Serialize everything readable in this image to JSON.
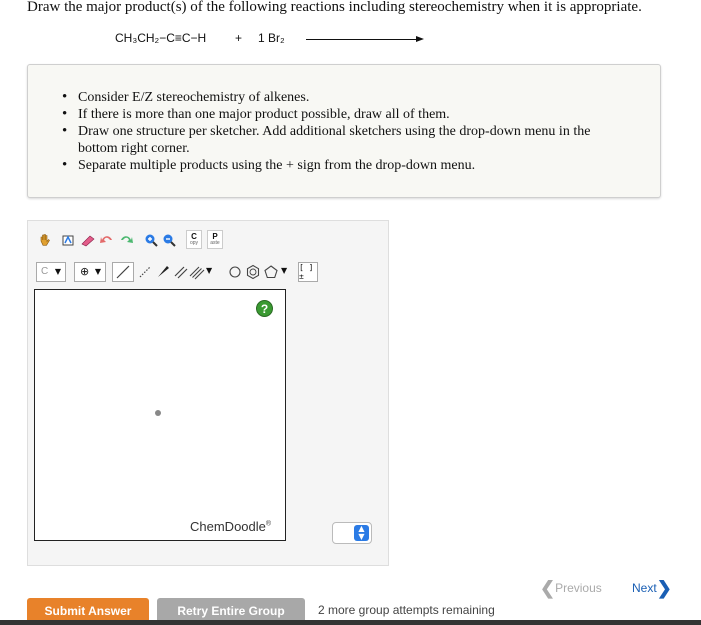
{
  "question": {
    "prompt": "Draw the major product(s) of the following reactions including stereochemistry when it is appropriate.",
    "reactant": "CH₃CH₂−C≡C−H",
    "plus": "+",
    "reagent": "1 Br₂"
  },
  "instructions": [
    "Consider E/Z stereochemistry of alkenes.",
    "If there is more than one major product possible, draw all of them.",
    "Draw one structure per sketcher. Add additional sketchers using the drop-down menu in the bottom right corner.",
    "Separate multiple products using the + sign from the drop-down menu."
  ],
  "toolbar": {
    "copy_label": "C",
    "copy_sub": "opy",
    "paste_label": "P",
    "paste_sub": "aste",
    "element_label": "C",
    "charge_label": "⊕",
    "bracket_label": "[ ]±"
  },
  "sketcher": {
    "help_label": "?",
    "brand": "ChemDoodle",
    "brand_mark": "®",
    "stepper_arrows": "▲▼"
  },
  "navigation": {
    "previous_label": "Previous",
    "next_label": "Next"
  },
  "actions": {
    "submit_label": "Submit Answer",
    "retry_label": "Retry Entire Group",
    "attempts_text": "2 more group attempts remaining"
  },
  "colors": {
    "submit": "#e8822a",
    "retry": "#a8a8a8",
    "next_link": "#1a5fb4",
    "help": "#3a9a32"
  }
}
